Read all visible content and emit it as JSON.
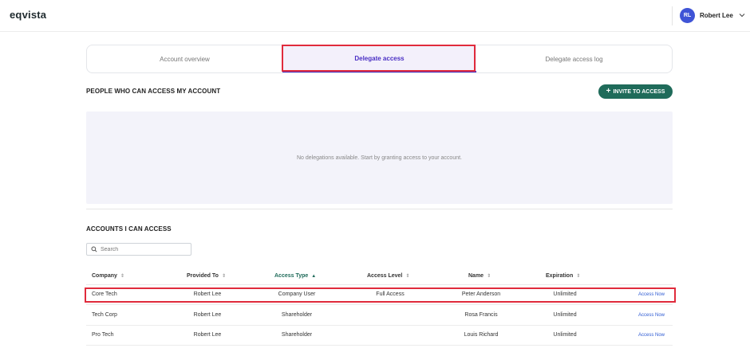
{
  "app": {
    "logo": "eqvista"
  },
  "user": {
    "initials": "RL",
    "name": "Robert Lee",
    "avatar_color": "#3f54d6"
  },
  "tabs": [
    {
      "label": "Account overview",
      "active": false
    },
    {
      "label": "Delegate access",
      "active": true
    },
    {
      "label": "Delegate access log",
      "active": false
    }
  ],
  "people_section": {
    "title": "PEOPLE WHO CAN ACCESS MY ACCOUNT",
    "invite_label": "INVITE TO ACCESS",
    "empty_message": "No delegations available. Start by granting access to your account."
  },
  "accounts_section": {
    "title": "ACCOUNTS I CAN ACCESS",
    "search_placeholder": "Search",
    "columns": [
      "Company",
      "Provided To",
      "Access Type",
      "Access Level",
      "Name",
      "Expiration"
    ],
    "sorted_column": "Access Type",
    "rows": [
      {
        "company": "Core Tech",
        "provided_to": "Robert Lee",
        "access_type": "Company User",
        "access_level": "Full Access",
        "name": "Peter Anderson",
        "expiration": "Unlimited",
        "action": "Access Now"
      },
      {
        "company": "Tech Corp",
        "provided_to": "Robert Lee",
        "access_type": "Shareholder",
        "access_level": "",
        "name": "Rosa Francis",
        "expiration": "Unlimited",
        "action": "Access Now"
      },
      {
        "company": "Pro Tech",
        "provided_to": "Robert Lee",
        "access_type": "Shareholder",
        "access_level": "",
        "name": "Louis Richard",
        "expiration": "Unlimited",
        "action": "Access Now"
      }
    ]
  },
  "colors": {
    "accent_purple": "#4a2fc4",
    "brand_green": "#1f6b5a",
    "highlight_red": "#e02b3c",
    "link_blue": "#2f5bd3"
  }
}
